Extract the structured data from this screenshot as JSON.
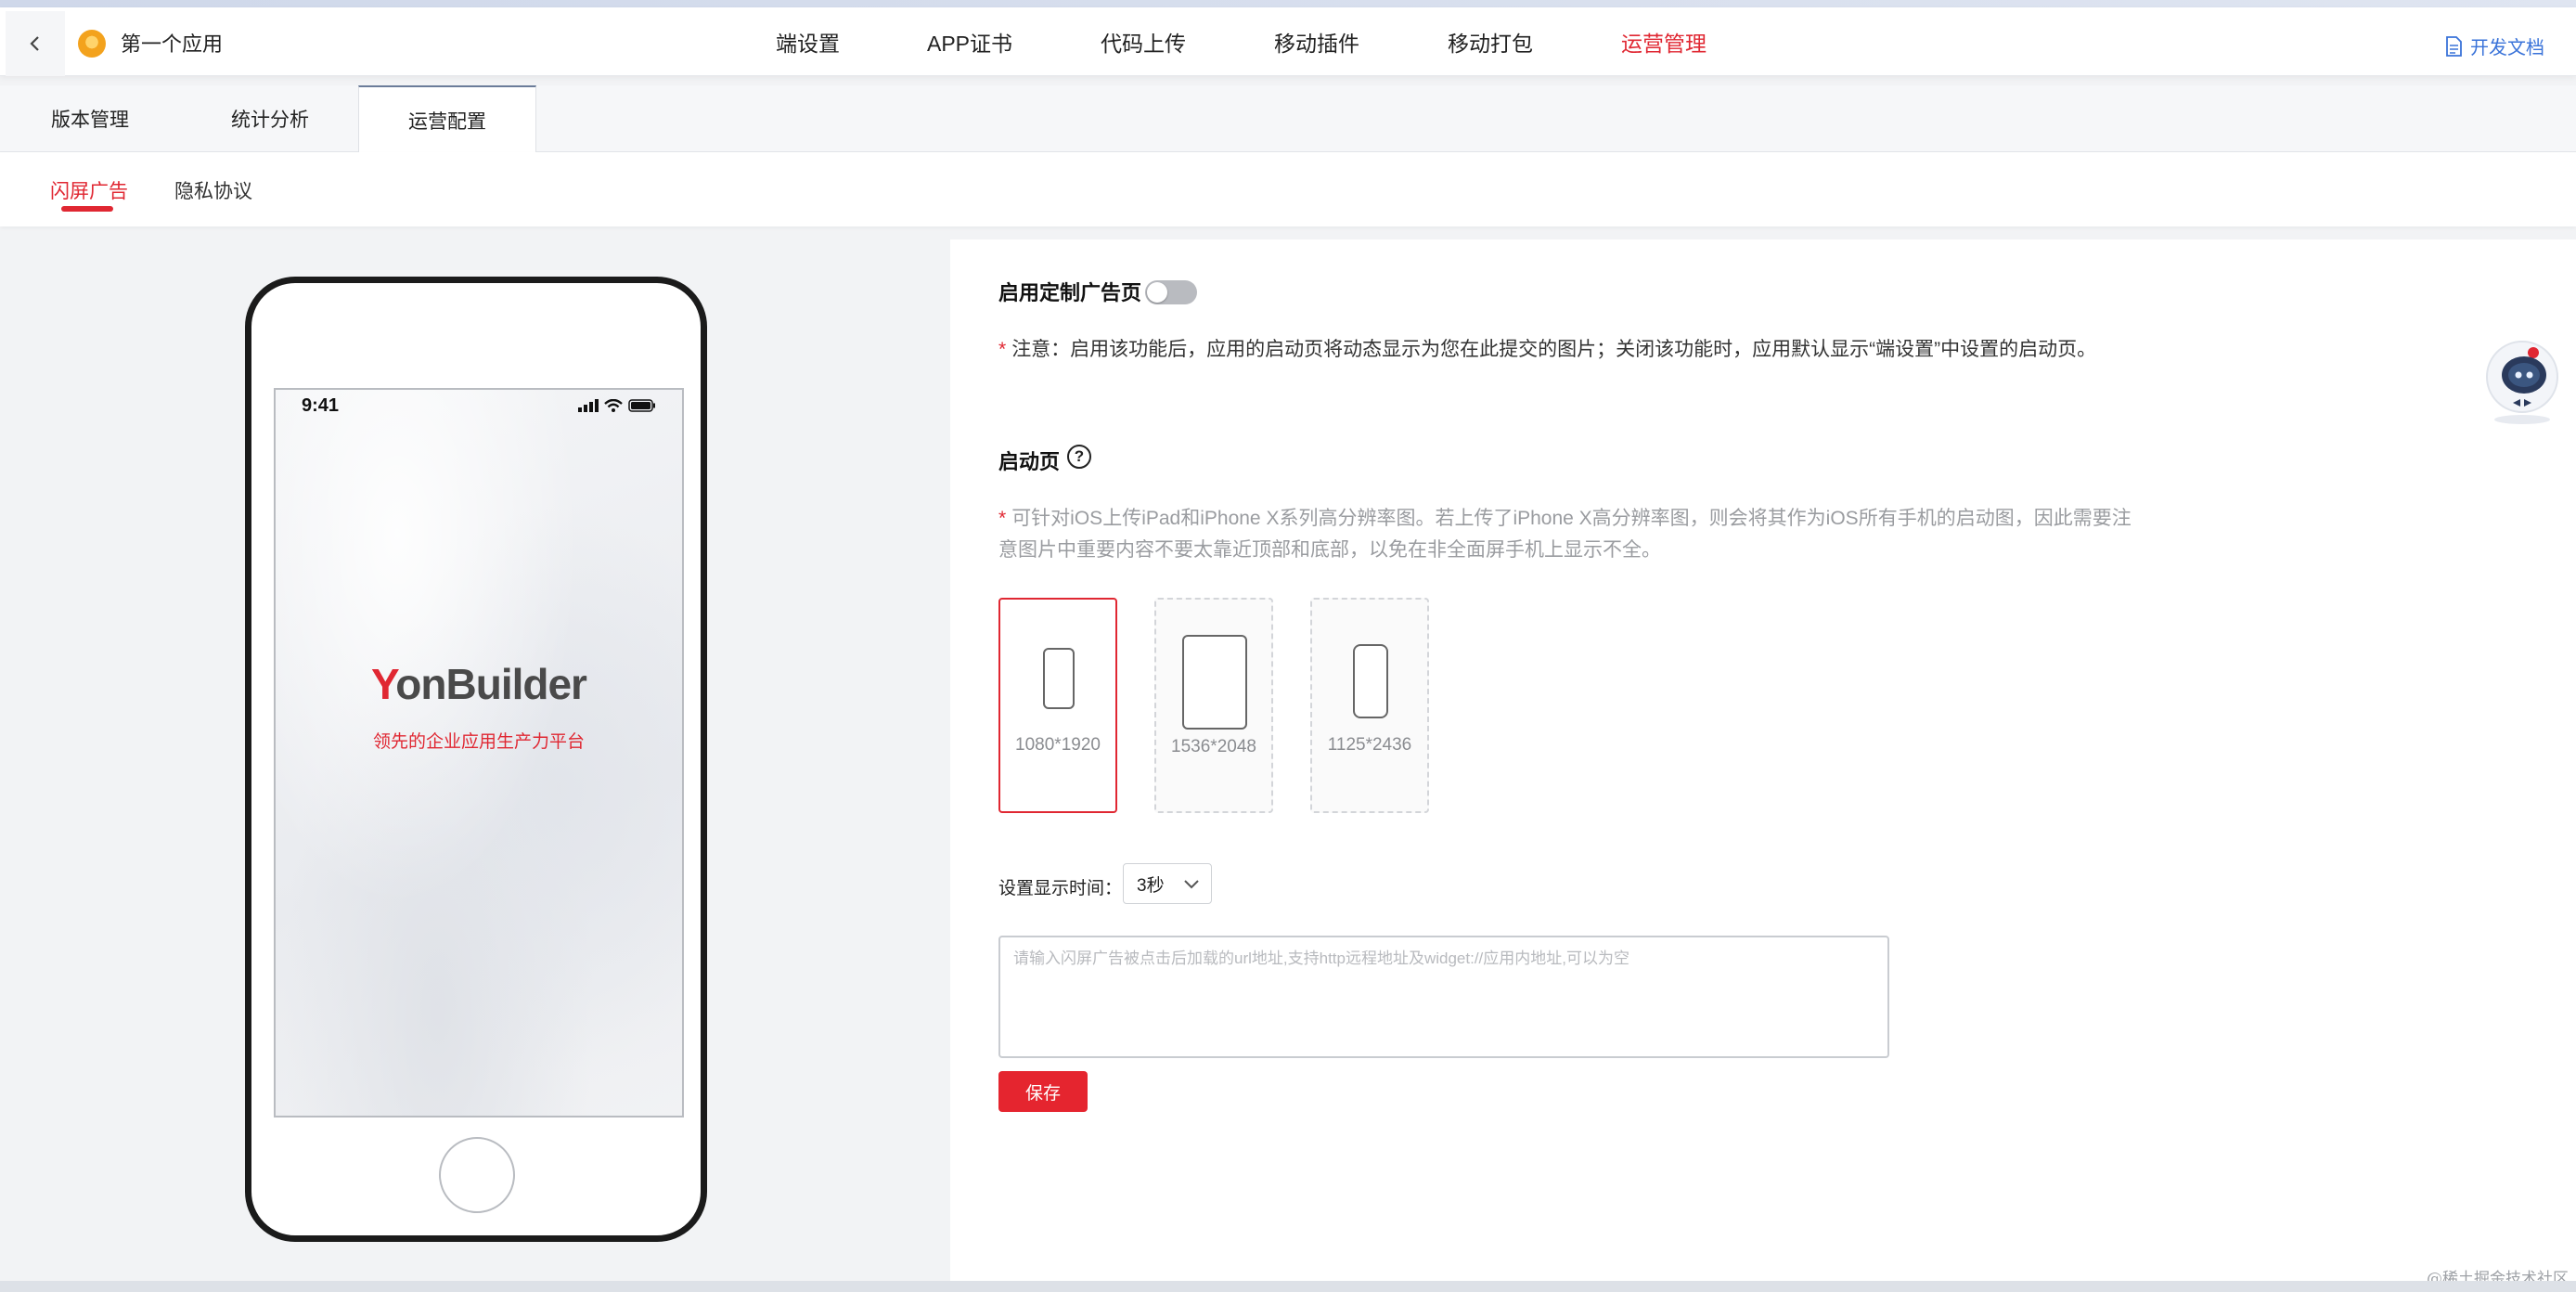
{
  "header": {
    "app_name": "第一个应用",
    "nav": [
      {
        "label": "端设置",
        "active": false
      },
      {
        "label": "APP证书",
        "active": false
      },
      {
        "label": "代码上传",
        "active": false
      },
      {
        "label": "移动插件",
        "active": false
      },
      {
        "label": "移动打包",
        "active": false
      },
      {
        "label": "运营管理",
        "active": true
      }
    ],
    "docs_label": "开发文档"
  },
  "tabs": [
    {
      "label": "版本管理",
      "active": false
    },
    {
      "label": "统计分析",
      "active": false
    },
    {
      "label": "运营配置",
      "active": true
    }
  ],
  "subtabs": [
    {
      "label": "闪屏广告",
      "active": true
    },
    {
      "label": "隐私协议",
      "active": false
    }
  ],
  "preview": {
    "status_time": "9:41",
    "brand": "YonBuilder",
    "slogan": "领先的企业应用生产力平台"
  },
  "settings": {
    "enable_title": "启用定制广告页",
    "enabled": false,
    "enable_note": "注意：启用该功能后，应用的启动页将动态显示为您在此提交的图片；关闭该功能时，应用默认显示“端设置”中设置的启动页。",
    "splash_title": "启动页",
    "splash_note_line1": "可针对iOS上传iPad和iPhone X系列高分辨率图。若上传了iPhone X高分辨率图，则会将其作为iOS所有手机的启动图，因此需要注",
    "splash_note_line2": "意图片中重要内容不要太靠近顶部和底部，以免在非全面屏手机上显示不全。",
    "sizes": [
      {
        "label": "1080*1920",
        "icon": "phone-icon",
        "selected": true
      },
      {
        "label": "1536*2048",
        "icon": "tablet-icon",
        "selected": false
      },
      {
        "label": "1125*2436",
        "icon": "phone-x-icon",
        "selected": false
      }
    ],
    "display_time_label": "设置显示时间：",
    "display_time_value": "3秒",
    "url_placeholder": "请输入闪屏广告被点击后加载的url地址,支持http远程地址及widget://应用内地址,可以为空",
    "save_label": "保存"
  },
  "watermark": "@稀土掘金技术社区",
  "colors": {
    "accent": "#e02732",
    "link": "#3a73d9"
  }
}
